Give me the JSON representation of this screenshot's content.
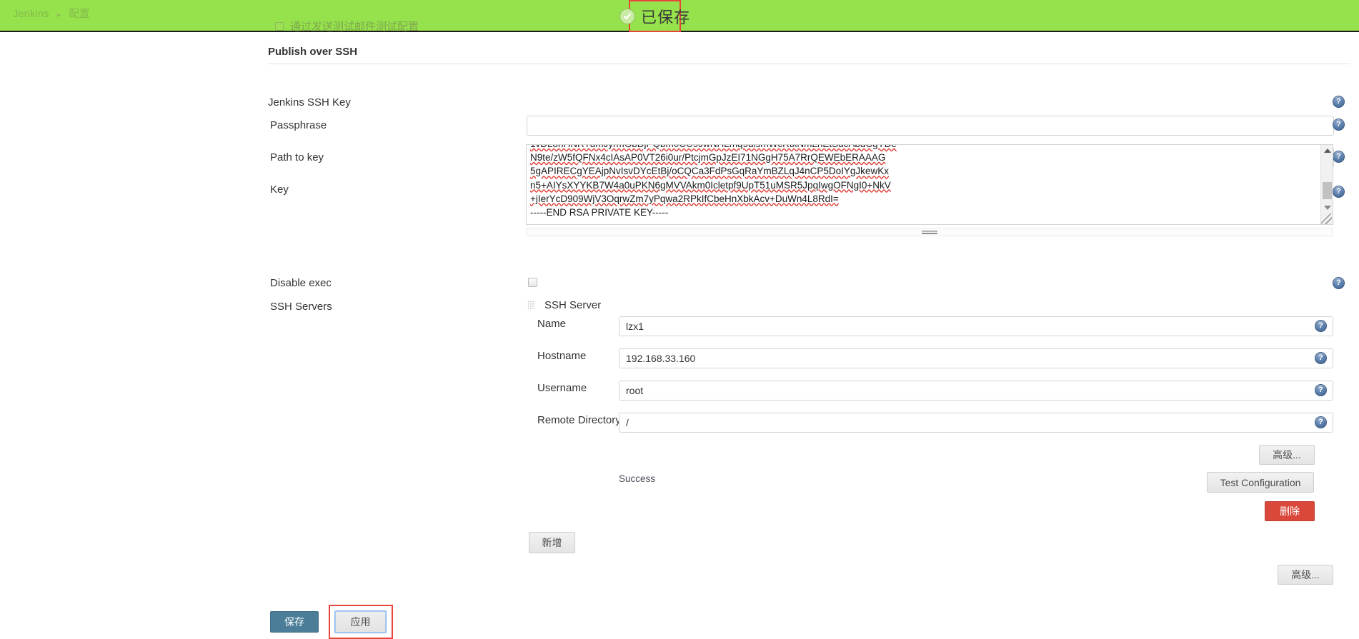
{
  "topbar": {
    "breadcrumb_root": "Jenkins",
    "breadcrumb_sep": "▸",
    "breadcrumb_current": "配置",
    "ghost_text": "通过发送测试邮件测试配置"
  },
  "toast": {
    "text": "已保存",
    "icon": "check-circle-icon",
    "highlight_color": "#e8443a",
    "bar_color": "#96e24c"
  },
  "section": {
    "title": "Publish over SSH"
  },
  "fields": {
    "jenkins_ssh_key_label": "Jenkins SSH Key",
    "passphrase_label": "Passphrase",
    "passphrase_value": "",
    "path_to_key_label": "Path to key",
    "path_to_key_value": "",
    "key_label": "Key",
    "key_value_lines": [
      "N9te/zW5fQFNx4cIAsAP0VT26i0ur/PtcjmGpJzEI71NGgH75A7RrQEWEbERAAAG",
      "5gAPIRECgYEAjpNvIsvDYcEtBj/oCQCa3FdPsGqRaYmBZLqJ4nCP5DoIYgJkewKx",
      "n5+AIYsXYYKB7W4a0uPKN6gMVVAkm0Icletpf9UpT51uMSR5JpqIwgOFNgI0+NkV",
      "+jIerYcD909WjV3OqrwZm7yPqwa2RPkIfCbeHnXbkAcv+DuWn4L8RdI=",
      "-----END RSA PRIVATE KEY-----"
    ],
    "disable_exec_label": "Disable exec",
    "disable_exec_checked": false,
    "ssh_servers_label": "SSH Servers"
  },
  "ssh_server": {
    "heading": "SSH Server",
    "name_label": "Name",
    "name_value": "lzx1",
    "hostname_label": "Hostname",
    "hostname_value": "192.168.33.160",
    "username_label": "Username",
    "username_value": "root",
    "remote_directory_label": "Remote Directory",
    "remote_directory_value": "/",
    "advanced_label": "高级...",
    "test_configuration_label": "Test Configuration",
    "delete_label": "删除",
    "status": "Success"
  },
  "actions": {
    "add_label": "新增",
    "advanced_label": "高级...",
    "save_label": "保存",
    "apply_label": "应用"
  },
  "help": {
    "glyph": "?"
  }
}
